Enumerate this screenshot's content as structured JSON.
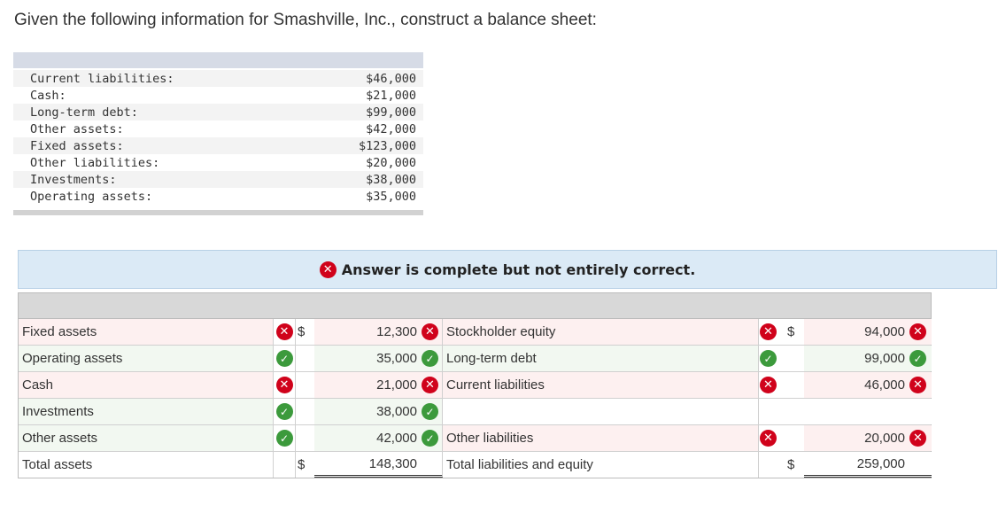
{
  "question": "Given the following information for Smashville, Inc., construct a balance sheet:",
  "given": [
    {
      "label": "Current liabilities:",
      "value": "$46,000"
    },
    {
      "label": "Cash:",
      "value": "$21,000"
    },
    {
      "label": "Long-term debt:",
      "value": "$99,000"
    },
    {
      "label": "Other assets:",
      "value": "$42,000"
    },
    {
      "label": "Fixed assets:",
      "value": "$123,000"
    },
    {
      "label": "Other liabilities:",
      "value": "$20,000"
    },
    {
      "label": "Investments:",
      "value": "$38,000"
    },
    {
      "label": "Operating assets:",
      "value": "$35,000"
    }
  ],
  "banner": {
    "text": "Answer is complete but not entirely correct.",
    "icon": "x-circle-icon",
    "color": "#d0021b"
  },
  "sheet": {
    "rows": [
      {
        "left_label": "Fixed assets",
        "left_status": "wrong",
        "left_dollar": "$",
        "left_amount": "12,300",
        "left_amt_status": "wrong",
        "right_label": "Stockholder equity",
        "right_status": "wrong",
        "right_dollar": "$",
        "right_amount": "94,000",
        "right_amt_status": "wrong"
      },
      {
        "left_label": "Operating assets",
        "left_status": "correct",
        "left_dollar": "",
        "left_amount": "35,000",
        "left_amt_status": "correct",
        "right_label": "Long-term debt",
        "right_status": "correct",
        "right_dollar": "",
        "right_amount": "99,000",
        "right_amt_status": "correct"
      },
      {
        "left_label": "Cash",
        "left_status": "wrong",
        "left_dollar": "",
        "left_amount": "21,000",
        "left_amt_status": "wrong",
        "right_label": "Current liabilities",
        "right_status": "wrong",
        "right_dollar": "",
        "right_amount": "46,000",
        "right_amt_status": "wrong"
      },
      {
        "left_label": "Investments",
        "left_status": "correct",
        "left_dollar": "",
        "left_amount": "38,000",
        "left_amt_status": "correct",
        "right_label": "",
        "right_status": "",
        "right_dollar": "",
        "right_amount": "",
        "right_amt_status": ""
      },
      {
        "left_label": "Other assets",
        "left_status": "correct",
        "left_dollar": "",
        "left_amount": "42,000",
        "left_amt_status": "correct",
        "right_label": "Other liabilities",
        "right_status": "wrong",
        "right_dollar": "",
        "right_amount": "20,000",
        "right_amt_status": "wrong"
      },
      {
        "left_label": "Total assets",
        "left_status": "",
        "left_dollar": "$",
        "left_amount": "148,300",
        "left_amt_status": "",
        "right_label": "Total liabilities and equity",
        "right_status": "",
        "right_dollar": "$",
        "right_amount": "259,000",
        "right_amt_status": ""
      }
    ]
  },
  "colors": {
    "wrong": "#d0021b",
    "correct": "#3c9a3c",
    "banner_bg": "#dbeaf6"
  }
}
